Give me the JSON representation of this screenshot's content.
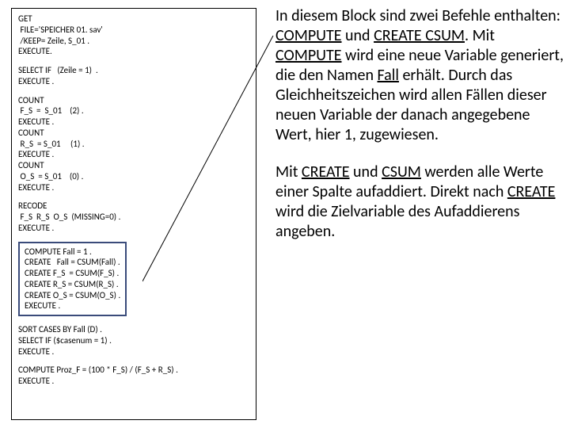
{
  "code": {
    "b1": "GET\n FILE='SPEICHER 01. sav'\n /KEEP= Zeile, S_01 .\nEXECUTE.",
    "b2": "SELECT IF   (Zeile = 1)  .\nEXECUTE .",
    "b3": "COUNT\n F_S  =  S_01    (2) .\nEXECUTE .\nCOUNT\n R_S  = S_01     (1) .\nEXECUTE .\nCOUNT\n O_S  = S_01    (0) .\nEXECUTE .",
    "b4": "RECODE\n F_S  R_S  O_S  (MISSING=0) .\nEXECUTE .",
    "b5": "COMPUTE Fall = 1 .\nCREATE   Fall = CSUM(Fall) .\nCREATE F_S  = CSUM(F_S) .\nCREATE R_S = CSUM(R_S) .\nCREATE O_S = CSUM(O_S) .\nEXECUTE .",
    "b6": "SORT CASES BY Fall (D) .\nSELECT IF ($casenum = 1) .\nEXECUTE .",
    "b7": "COMPUTE Proz_F = (100 * F_S) / (F_S + R_S) .\nEXECUTE ."
  },
  "para1": {
    "t1": "In diesem Block sind zwei Befehle enthalten: ",
    "compute1": "COMPUTE",
    "t2": " und ",
    "createcsum": "CREATE CSUM",
    "t3": ".  Mit ",
    "compute2": "COMPUTE",
    "t4": " wird eine neue Variable generiert, die den Namen ",
    "fall": "Fall",
    "t5": " erhält. Durch das Gleichheitszeichen wird allen Fällen dieser neuen Variable der danach angegebene Wert, hier 1, zugewiesen."
  },
  "para2": {
    "t1": "Mit ",
    "create": "CREATE",
    "t2": " und ",
    "csum": "CSUM",
    "t3": " werden alle Werte einer Spalte auf­addiert. Direkt nach ",
    "create2": "CREATE",
    "t4": " wird die Zielvariable des Aufaddierens angeben."
  }
}
